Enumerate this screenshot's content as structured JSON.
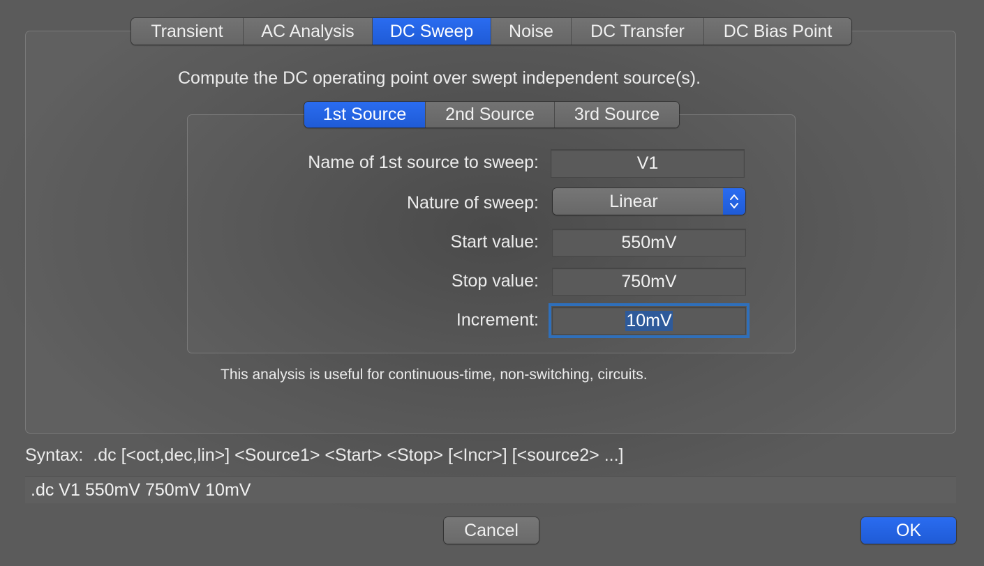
{
  "analysis_tabs": [
    {
      "label": "Transient",
      "active": false
    },
    {
      "label": "AC Analysis",
      "active": false
    },
    {
      "label": "DC Sweep",
      "active": true
    },
    {
      "label": "Noise",
      "active": false
    },
    {
      "label": "DC Transfer",
      "active": false
    },
    {
      "label": "DC Bias Point",
      "active": false
    }
  ],
  "description": "Compute the DC operating point over swept independent source(s).",
  "source_tabs": [
    {
      "label": "1st Source",
      "active": true
    },
    {
      "label": "2nd Source",
      "active": false
    },
    {
      "label": "3rd Source",
      "active": false
    }
  ],
  "form": {
    "source_name_label": "Name of 1st source to sweep:",
    "source_name_value": "V1",
    "nature_label": "Nature of sweep:",
    "nature_value": "Linear",
    "start_label": "Start value:",
    "start_value": "550mV",
    "stop_label": "Stop value:",
    "stop_value": "750mV",
    "increment_label": "Increment:",
    "increment_value": "10mV"
  },
  "note": "This analysis is useful for continuous-time, non-switching, circuits.",
  "syntax": {
    "label": "Syntax:",
    "text": ".dc [<oct,dec,lin>] <Source1> <Start> <Stop> [<Incr>] [<source2> ...]"
  },
  "command": ".dc V1 550mV 750mV 10mV",
  "buttons": {
    "cancel": "Cancel",
    "ok": "OK"
  },
  "colors": {
    "accent": "#2463e0",
    "focus_ring": "#2f6fba",
    "background": "#4c4c4c"
  }
}
